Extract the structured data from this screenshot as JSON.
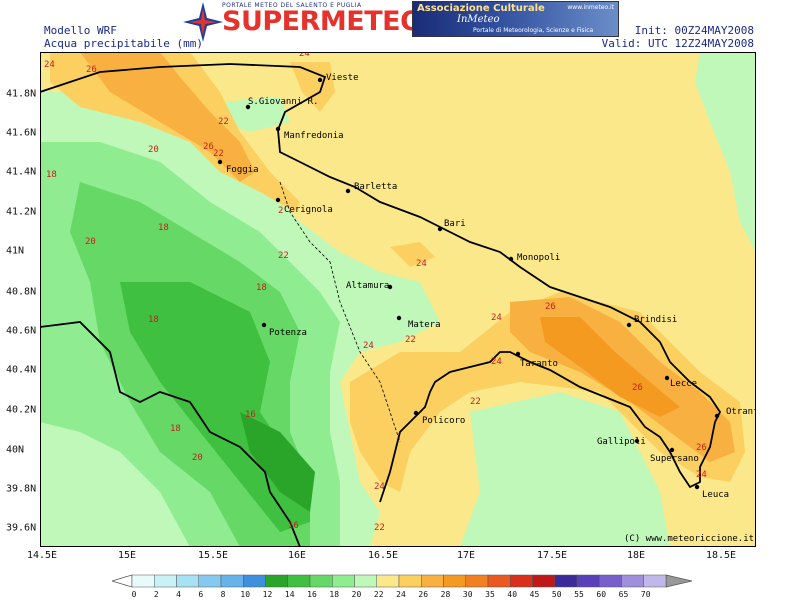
{
  "header": {
    "model": "Modello WRF",
    "variable": "Acqua precipitabile (mm)",
    "init": "Init: 00Z24MAY2008",
    "valid": "Valid: UTC 12Z24MAY2008"
  },
  "logo": {
    "name": "SUPERMETEO",
    "tagline": "PORTALE METEO DEL SALENTO E PUGLIA"
  },
  "banner": {
    "title": "Associazione Culturale",
    "brand": "InMeteo",
    "url": "www.inmeteo.it",
    "subtitle": "Portale di Meteorologia, Scienze e Fisica"
  },
  "axes": {
    "x_ticks": [
      "14.5E",
      "15E",
      "15.5E",
      "16E",
      "16.5E",
      "17E",
      "17.5E",
      "18E",
      "18.5E"
    ],
    "y_ticks": [
      "41.8N",
      "41.6N",
      "41.4N",
      "41.2N",
      "41N",
      "40.8N",
      "40.6N",
      "40.4N",
      "40.2N",
      "40N",
      "39.8N",
      "39.6N"
    ]
  },
  "cities": [
    {
      "name": "Vieste"
    },
    {
      "name": "S.Giovanni R."
    },
    {
      "name": "Manfredonia"
    },
    {
      "name": "Foggia"
    },
    {
      "name": "Barletta"
    },
    {
      "name": "Cerignola"
    },
    {
      "name": "Bari"
    },
    {
      "name": "Monopoli"
    },
    {
      "name": "Altamura"
    },
    {
      "name": "Matera"
    },
    {
      "name": "Potenza"
    },
    {
      "name": "Brindisi"
    },
    {
      "name": "Taranto"
    },
    {
      "name": "Lecce"
    },
    {
      "name": "Otranto"
    },
    {
      "name": "Policoro"
    },
    {
      "name": "Gallipoli"
    },
    {
      "name": "Supersano"
    },
    {
      "name": "Leuca"
    }
  ],
  "contour_labels": [
    "24",
    "26",
    "22",
    "26",
    "20",
    "18",
    "18",
    "20",
    "22",
    "18",
    "18",
    "16",
    "18",
    "20",
    "16",
    "22",
    "24",
    "24",
    "24",
    "22",
    "24",
    "26",
    "24",
    "22",
    "24",
    "26",
    "26",
    "24",
    "22",
    "2"
  ],
  "credit": "(C) www.meteoriccione.it",
  "colorbar": {
    "levels": [
      "0",
      "2",
      "4",
      "6",
      "8",
      "10",
      "12",
      "14",
      "16",
      "18",
      "20",
      "22",
      "24",
      "26",
      "28",
      "30",
      "35",
      "40",
      "45",
      "50",
      "55",
      "60",
      "65",
      "70"
    ],
    "colors": [
      "#e8fbfb",
      "#c8f2f6",
      "#a6e2f4",
      "#86c8f0",
      "#66b2ea",
      "#3f8fdf",
      "#2aa52a",
      "#40c040",
      "#66d866",
      "#90ec90",
      "#bff8b8",
      "#fbe88a",
      "#fbd060",
      "#f8b040",
      "#f59a20",
      "#f08020",
      "#e85a20",
      "#d8301c",
      "#c01818",
      "#3c2a9a",
      "#5a40b8",
      "#7860cc",
      "#a090dc",
      "#c0b8e8"
    ]
  },
  "colors": {
    "land_outline": "#000000",
    "header_text": "#1a2a8a",
    "contour_label": "#c81e1e"
  }
}
